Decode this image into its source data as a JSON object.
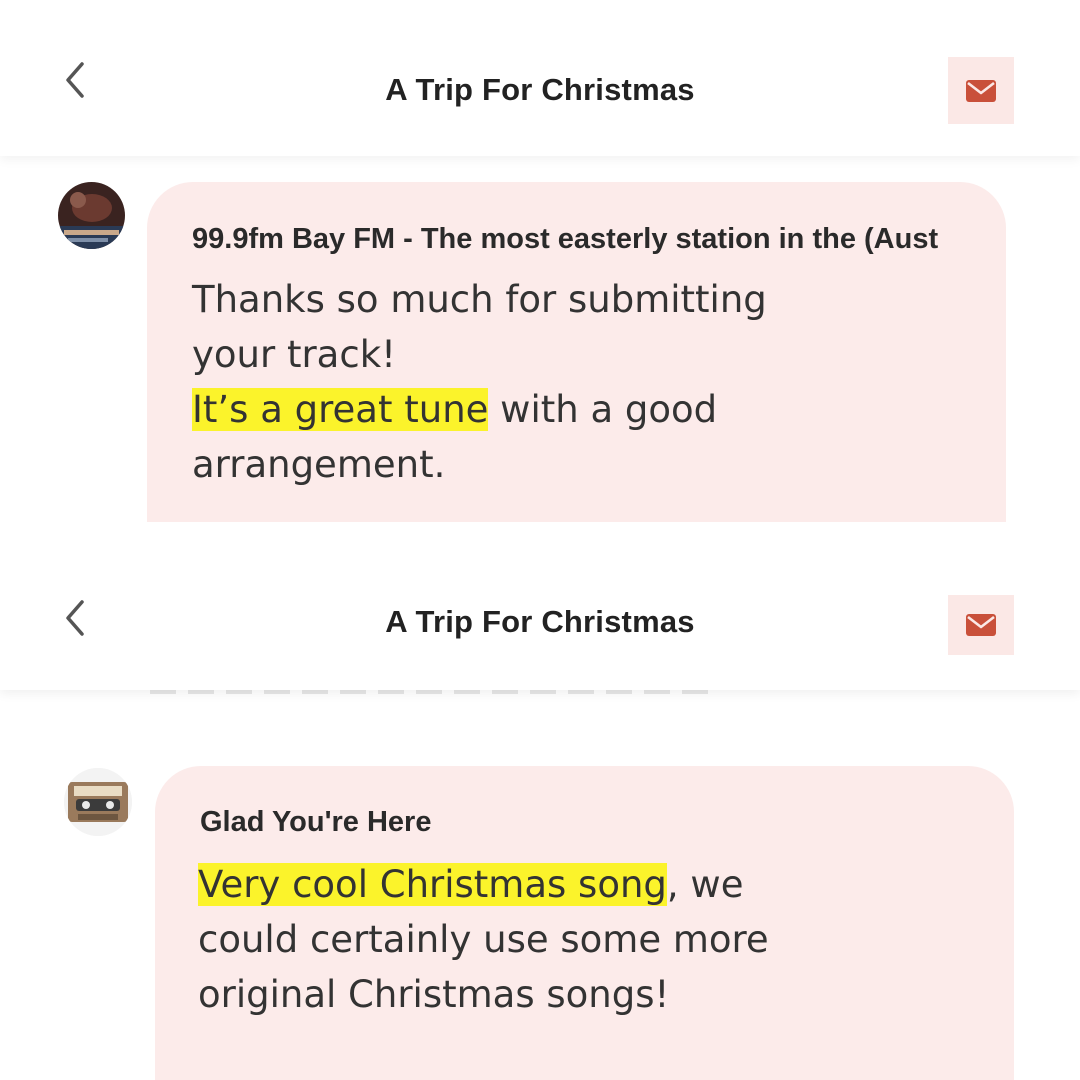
{
  "screens": [
    {
      "header": {
        "title": "A Trip For Christmas",
        "back_icon": "chevron-left-icon",
        "mail_icon": "envelope-icon"
      },
      "message": {
        "sender": "99.9fm Bay FM - The most easterly station in the (Aust",
        "lines": [
          "Thanks so much for submitting",
          "your track!"
        ],
        "highlight": "It’s a great tune",
        "highlight_rest": " with a good",
        "last_line": "arrangement."
      }
    },
    {
      "header": {
        "title": "A Trip For Christmas",
        "back_icon": "chevron-left-icon",
        "mail_icon": "envelope-icon"
      },
      "message": {
        "sender": "Glad You're Here",
        "highlight": "Very cool Christmas song",
        "highlight_rest": ", we",
        "lines": [
          "could certainly use some more",
          "original Christmas songs!"
        ]
      }
    }
  ],
  "colors": {
    "accent": "#c9503a",
    "bubble": "#fcebea",
    "highlight": "#fbf32b",
    "button_bg": "#fbe8e6"
  }
}
